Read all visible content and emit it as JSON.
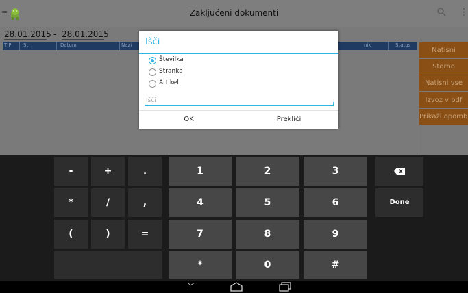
{
  "action_bar": {
    "title": "Zaključeni dokumenti",
    "menu_glyph": "≡",
    "logo_icon": "android-app-icon",
    "search_glyph": "🔍",
    "overflow_glyph": "⋮"
  },
  "date_filter": {
    "from": "28.01.2015",
    "separator": "-",
    "to": "28.01.2015"
  },
  "grid": {
    "columns": [
      "TIP",
      "Št.",
      "Datum",
      "Nazi",
      "",
      "",
      "nik",
      "Status"
    ]
  },
  "side_buttons": [
    "Natisni",
    "Storno",
    "Natisni vse",
    "Izvoz v pdf",
    "Prikaži opombe"
  ],
  "dialog": {
    "title": "Išči",
    "options": [
      {
        "label": "Številka",
        "selected": true
      },
      {
        "label": "Stranka",
        "selected": false
      },
      {
        "label": "Artikel",
        "selected": false
      }
    ],
    "search_placeholder": "Išči",
    "ok_label": "OK",
    "cancel_label": "Prekliči"
  },
  "keyboard": {
    "symbol_keys": [
      "-",
      "+",
      ".",
      "*",
      "/",
      ",",
      "(",
      ")",
      "="
    ],
    "digit_keys": [
      "1",
      "2",
      "3",
      "4",
      "5",
      "6",
      "7",
      "8",
      "9",
      "*",
      "0",
      "#"
    ],
    "backspace_glyph": "⌫",
    "done_label": "Done"
  },
  "nav": {
    "back_glyph": "﹀",
    "home_glyph": "⌂",
    "recents_glyph": "▭"
  },
  "colors": {
    "accent": "#33b5e5",
    "side_button": "#8a4f14",
    "grid_header": "#1f3b61"
  }
}
